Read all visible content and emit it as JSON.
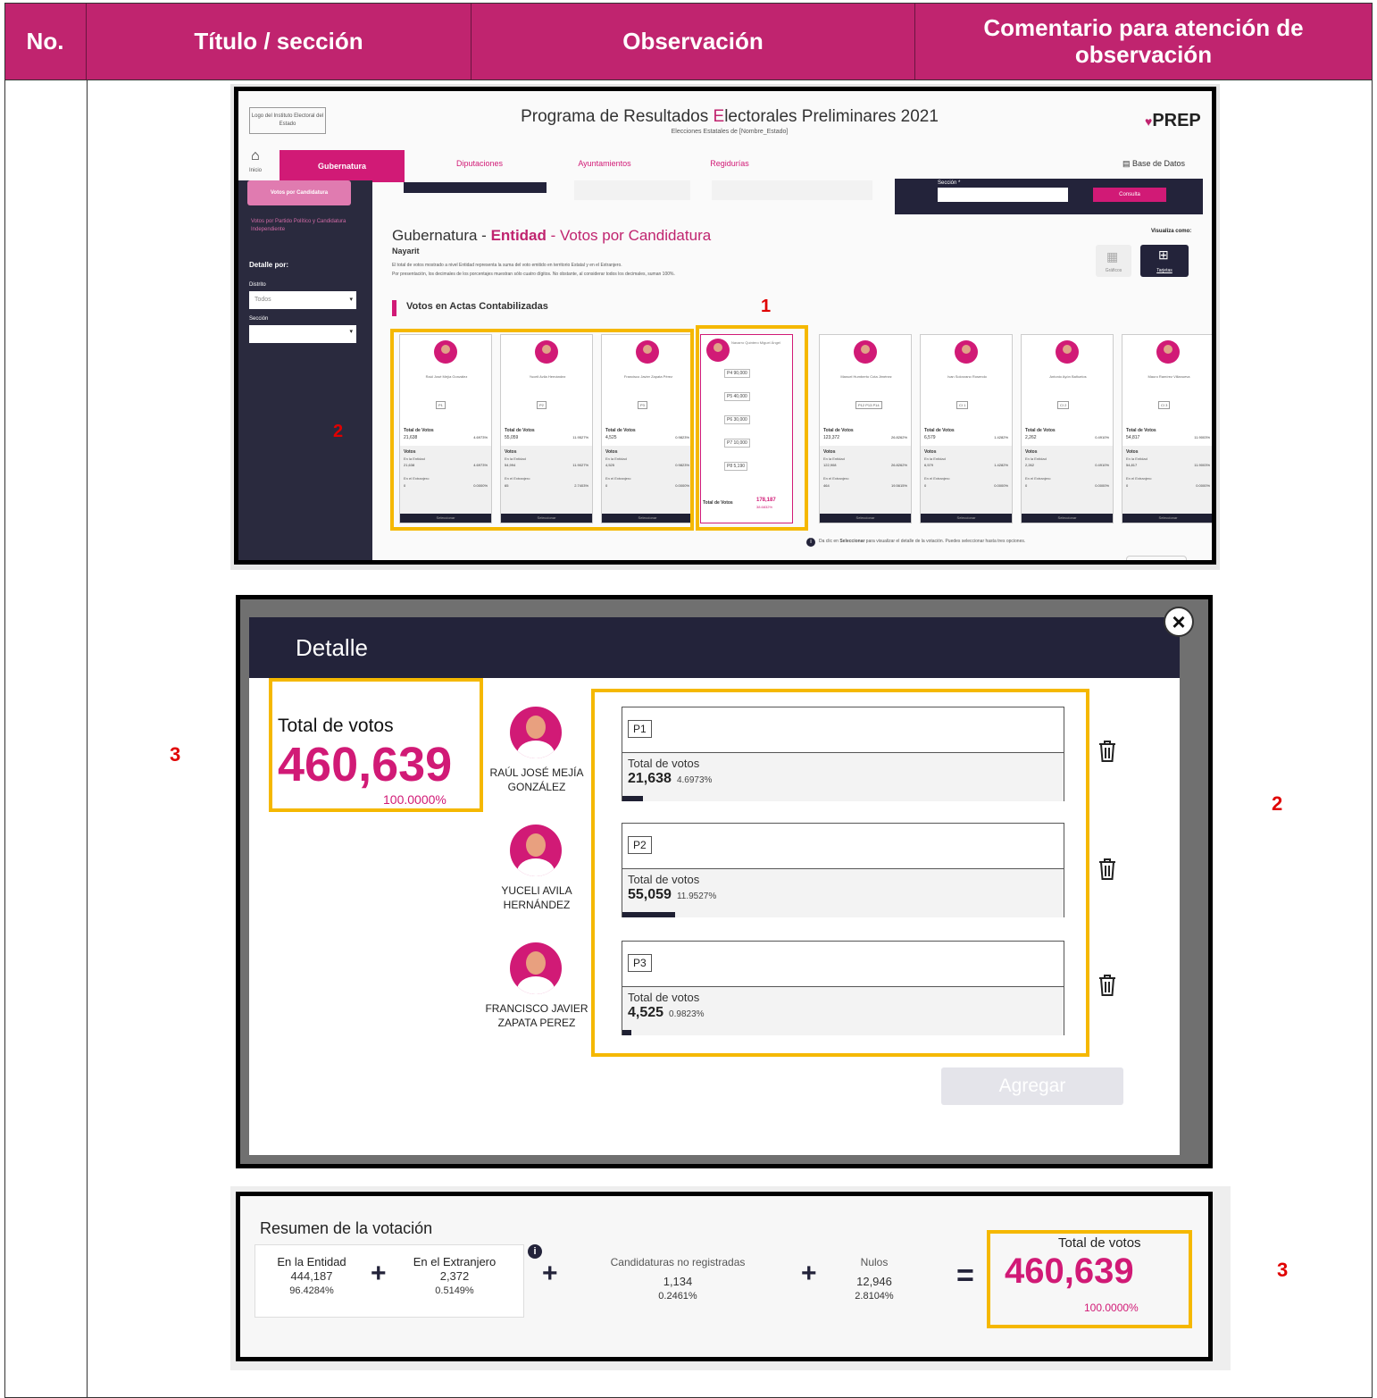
{
  "table": {
    "headers": {
      "no": "No.",
      "titulo": "Título / sección",
      "observacion": "Observación",
      "comentario": "Comentario para atención de observación"
    },
    "markers": {
      "one": "1",
      "two": "2",
      "three": "3"
    }
  },
  "shot1": {
    "logo_text": "Logo del Instituto Electoral del Estado",
    "title_prefix": "Programa de Resultados ",
    "title_e": "E",
    "title_suffix": "lectorales Preliminares 2021",
    "subtitle": "Elecciones Estatales de [Nombre_Estado]",
    "prep_logo": "PREP",
    "home": "Inicio",
    "tabs": [
      "Gubernatura",
      "Diputaciones",
      "Ayuntamientos",
      "Regidurías"
    ],
    "db_link": "Base de Datos",
    "side_votes_btn": "Votos por Candidatura",
    "side_parties": "Votos por Partido Político y Candidatura Independiente",
    "detail_by": "Detalle por:",
    "distrito_label": "Distrito",
    "distrito_value": "Todos",
    "seccion_label": "Sección",
    "seccion_field_label": "Sección *",
    "consulta_btn": "Consulta",
    "heading_prefix": "Gubernatura - ",
    "heading_entity": "Entidad",
    "heading_suffix": " - Votos por Candidatura",
    "state": "Nayarit",
    "note1": "El total de votos mostrado a nivel Entidad representa la suma del voto emitido en territorio Estatal y en el Extranjero.",
    "note2": "Por presentación, los decimales de los porcentajes muestran sólo cuatro dígitos. No obstante, al considerar todos los decimales, suman 100%.",
    "view_as": "Visualiza como:",
    "view_graphs": "Gráficos",
    "view_tables": "Tarjetas",
    "section_title": "Votos en Actas Contabilizadas",
    "footer_note_prefix": "Da clic en ",
    "footer_note_bold": "Seleccionar",
    "footer_note_suffix": " para visualizar el detalle de la votación. Puedes seleccionar hasta tres opciones.",
    "see_detail": "Ver detalle",
    "card_total_label": "Total de Votos",
    "card_votes_label": "Votos",
    "card_entity_label": "En la Entidad",
    "card_abroad_label": "En el Extranjero",
    "card_select": "Seleccionar",
    "cards": [
      {
        "name": "Raúl José Mejía González",
        "party": "P1",
        "total": "21,638",
        "pct": "4.6973%",
        "entity": "21,638",
        "entity_pct": "4.6973%",
        "abroad": "0",
        "abroad_pct": "0.0000%"
      },
      {
        "name": "Yuceli Avila Hernández",
        "party": "P2",
        "total": "55,059",
        "pct": "11.9527%",
        "entity": "54,994",
        "entity_pct": "11.9027%",
        "abroad": "65",
        "abroad_pct": "2.7403%"
      },
      {
        "name": "Francisco Javier Zapata Pérez",
        "party": "P3",
        "total": "4,525",
        "pct": "0.9823%",
        "entity": "4,525",
        "entity_pct": "0.9823%",
        "abroad": "0",
        "abroad_pct": "0.0000%"
      },
      {
        "name": "Manuel Humberto Cota Jiménez",
        "party": "P12 P13 P14",
        "total": "123,372",
        "pct": "26.8262%",
        "entity": "122,908",
        "entity_pct": "26.8262%",
        "abroad": "464",
        "abroad_pct": "19.5615%"
      },
      {
        "name": "Ivan Solorzano Rosendo",
        "party": "CI 1",
        "total": "6,579",
        "pct": "1.4282%",
        "entity": "6,579",
        "entity_pct": "1.4282%",
        "abroad": "0",
        "abroad_pct": "0.0000%"
      },
      {
        "name": "Antonio Ayón Bañuelos",
        "party": "CI 2",
        "total": "2,262",
        "pct": "0.4910%",
        "entity": "2,262",
        "entity_pct": "0.4910%",
        "abroad": "0",
        "abroad_pct": "0.0000%"
      },
      {
        "name": "Mauro Ramírez Villanueva",
        "party": "CI 3",
        "total": "54,817",
        "pct": "11.9003%",
        "entity": "54,817",
        "entity_pct": "11.9003%",
        "abroad": "0",
        "abroad_pct": "0.0000%"
      }
    ],
    "coalition": {
      "name": "Navarro Quintero Miguel Ángel",
      "rows": [
        "P4 90,000",
        "P5 40,000",
        "P6 30,000",
        "P7 10,000",
        "P8 5,190"
      ],
      "total_label": "Total de Votos",
      "total": "178,187",
      "pct": "38.6832%"
    }
  },
  "shot2": {
    "title": "Detalle",
    "close": "×",
    "total_label": "Total de votos",
    "total_value": "460,639",
    "total_pct": "100.0000%",
    "candidates": [
      {
        "name": "RAÚL JOSÉ MEJÍA GONZÁLEZ",
        "party": "P1",
        "label": "Total de votos",
        "votes": "21,638",
        "pct": "4.6973%"
      },
      {
        "name": "YUCELI AVILA HERNÁNDEZ",
        "party": "P2",
        "label": "Total de votos",
        "votes": "55,059",
        "pct": "11.9527%"
      },
      {
        "name": "FRANCISCO JAVIER ZAPATA PEREZ",
        "party": "P3",
        "label": "Total de votos",
        "votes": "4,525",
        "pct": "0.9823%"
      }
    ],
    "bar_fractions": [
      0.047,
      0.12,
      0.018
    ],
    "add_button": "Agregar"
  },
  "shot3": {
    "title": "Resumen de la votación",
    "entidad_label": "En la Entidad",
    "entidad_value": "444,187",
    "entidad_pct": "96.4284%",
    "extranjero_label": "En el Extranjero",
    "extranjero_value": "2,372",
    "extranjero_pct": "0.5149%",
    "no_reg_label": "Candidaturas no registradas",
    "no_reg_value": "1,134",
    "no_reg_pct": "0.2461%",
    "nulos_label": "Nulos",
    "nulos_value": "12,946",
    "nulos_pct": "2.8104%",
    "total_label": "Total de votos",
    "total_value": "460,639",
    "total_pct": "100.0000%",
    "plus": "+",
    "equals": "="
  },
  "colors": {
    "header_magenta": "#c0246f",
    "prep_magenta": "#d11a76",
    "highlight_yellow": "#f5b800",
    "navy": "#23233a",
    "marker_red": "#e00000"
  }
}
